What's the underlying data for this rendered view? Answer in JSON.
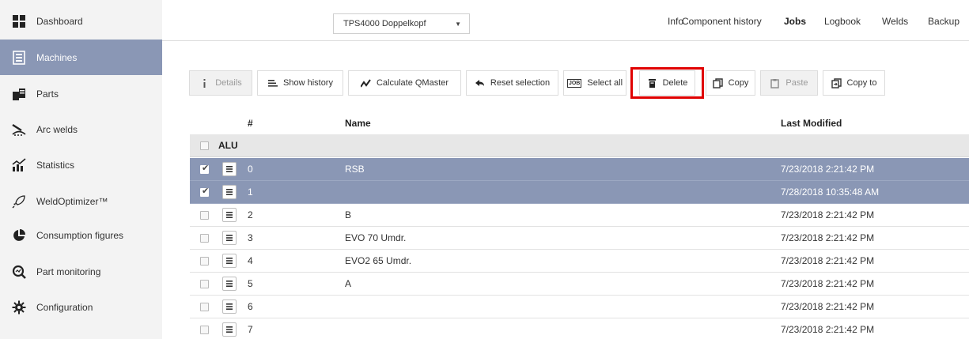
{
  "sidebar": {
    "items": [
      {
        "label": "Dashboard",
        "icon": "dashboard-icon",
        "active": false
      },
      {
        "label": "Machines",
        "icon": "machines-icon",
        "active": true
      },
      {
        "label": "Parts",
        "icon": "parts-icon",
        "active": false
      },
      {
        "label": "Arc welds",
        "icon": "arc-welds-icon",
        "active": false
      },
      {
        "label": "Statistics",
        "icon": "statistics-icon",
        "active": false
      },
      {
        "label": "WeldOptimizer™",
        "icon": "rocket-icon",
        "active": false
      },
      {
        "label": "Consumption figures",
        "icon": "pie-chart-icon",
        "active": false
      },
      {
        "label": "Part monitoring",
        "icon": "part-monitoring-icon",
        "active": false
      },
      {
        "label": "Configuration",
        "icon": "gear-icon",
        "active": false
      }
    ]
  },
  "header": {
    "machine_select": "TPS4000 Doppelkopf",
    "tabs": [
      {
        "label": "Info",
        "active": false
      },
      {
        "label": "Component history",
        "active": false
      },
      {
        "label": "Jobs",
        "active": true
      },
      {
        "label": "Logbook",
        "active": false
      },
      {
        "label": "Welds",
        "active": false
      },
      {
        "label": "Backup",
        "active": false
      }
    ]
  },
  "toolbar": {
    "details": "Details",
    "show_history": "Show history",
    "calculate_qmaster": "Calculate QMaster",
    "reset_selection": "Reset selection",
    "select_all": "Select all",
    "select_all_icon_text": "JOB",
    "delete": "Delete",
    "copy": "Copy",
    "paste": "Paste",
    "copy_to": "Copy to"
  },
  "table": {
    "columns": {
      "num": "#",
      "name": "Name",
      "modified": "Last Modified"
    },
    "group": "ALU",
    "rows": [
      {
        "num": "0",
        "name": "RSB",
        "modified": "7/23/2018 2:21:42 PM",
        "selected": true
      },
      {
        "num": "1",
        "name": "",
        "modified": "7/28/2018 10:35:48 AM",
        "selected": true
      },
      {
        "num": "2",
        "name": "B",
        "modified": "7/23/2018 2:21:42 PM",
        "selected": false
      },
      {
        "num": "3",
        "name": "EVO 70 Umdr.",
        "modified": "7/23/2018 2:21:42 PM",
        "selected": false
      },
      {
        "num": "4",
        "name": "EVO2 65 Umdr.",
        "modified": "7/23/2018 2:21:42 PM",
        "selected": false
      },
      {
        "num": "5",
        "name": "A",
        "modified": "7/23/2018 2:21:42 PM",
        "selected": false
      },
      {
        "num": "6",
        "name": "",
        "modified": "7/23/2018 2:21:42 PM",
        "selected": false
      },
      {
        "num": "7",
        "name": "",
        "modified": "7/23/2018 2:21:42 PM",
        "selected": false
      }
    ]
  },
  "colors": {
    "accent": "#8a97b5",
    "highlight": "#e00000",
    "sidebar_bg": "#f3f3f3"
  }
}
